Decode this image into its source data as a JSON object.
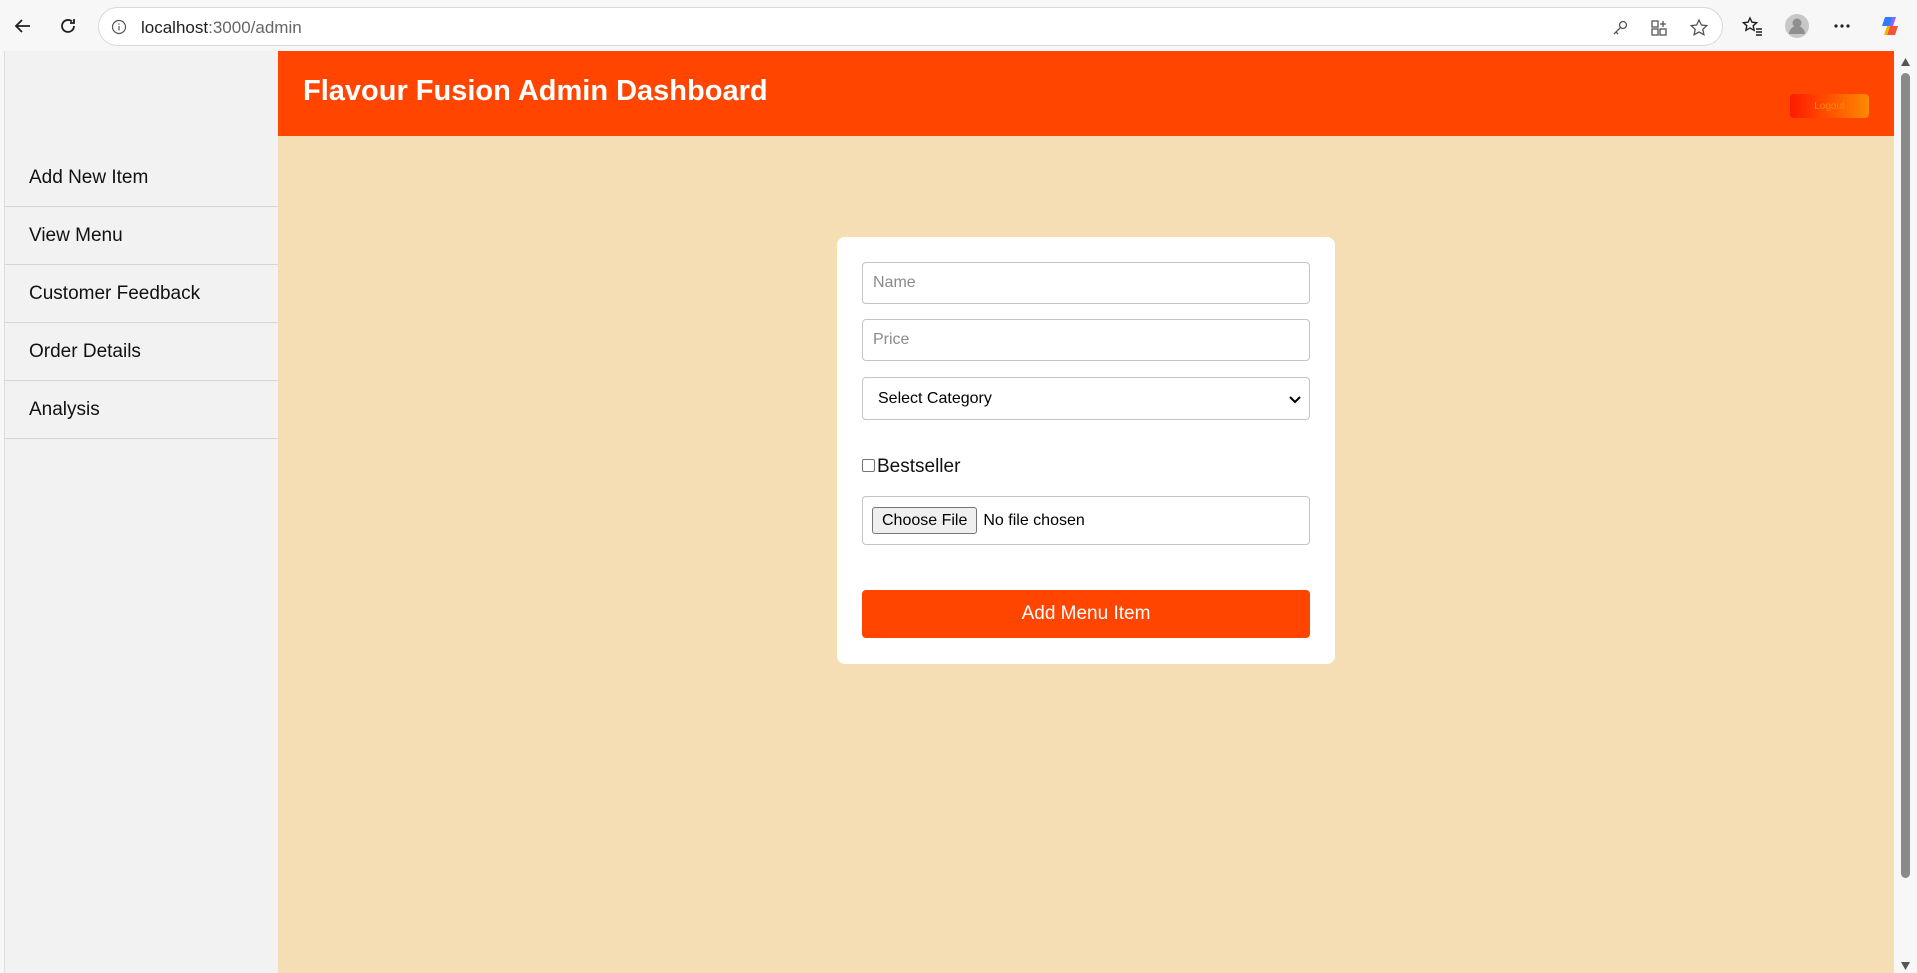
{
  "browser": {
    "url_host": "localhost",
    "url_path": ":3000/admin"
  },
  "sidebar": {
    "items": [
      {
        "label": "Add New Item"
      },
      {
        "label": "View Menu"
      },
      {
        "label": "Customer Feedback"
      },
      {
        "label": "Order Details"
      },
      {
        "label": "Analysis"
      }
    ]
  },
  "header": {
    "title": "Flavour Fusion Admin Dashboard",
    "logout_label": "Logout"
  },
  "form": {
    "name_placeholder": "Name",
    "price_placeholder": "Price",
    "category_selected": "Select Category",
    "bestseller_label": "Bestseller",
    "bestseller_checked": false,
    "choose_file_label": "Choose File",
    "file_status": "No file chosen",
    "submit_label": "Add Menu Item"
  },
  "colors": {
    "header": "#ff4500",
    "main_background": "#f5deb3",
    "submit_button": "#ff4500"
  }
}
